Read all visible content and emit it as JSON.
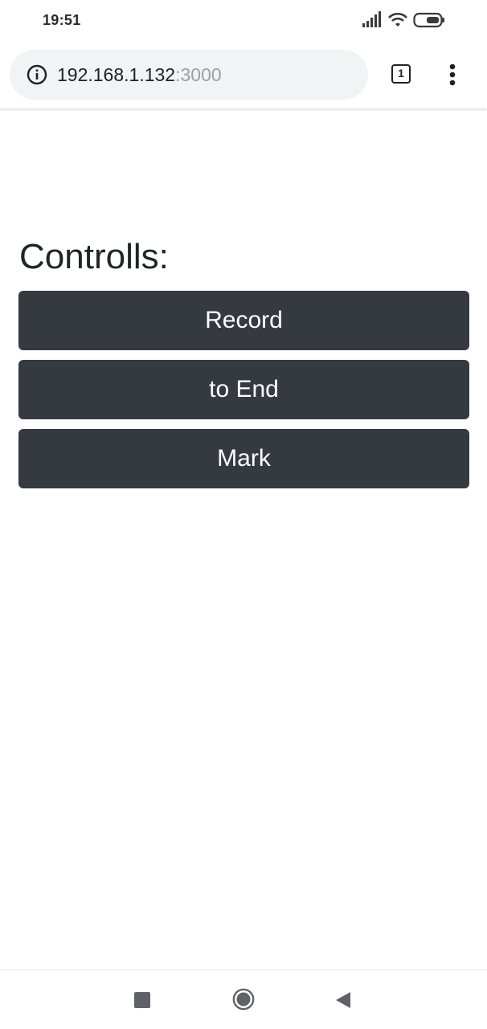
{
  "status_bar": {
    "time": "19:51",
    "icons": [
      "signal-icon",
      "wifi-icon",
      "battery-icon"
    ]
  },
  "browser": {
    "url_host": "192.168.1.132",
    "url_port": ":3000",
    "tab_count": "1",
    "icons": [
      "info-icon",
      "tab-switcher-icon",
      "more-vert-icon"
    ]
  },
  "page": {
    "title": "Controlls:",
    "buttons": {
      "record": "Record",
      "to_end": "to End",
      "mark": "Mark"
    },
    "button_color": "#343a40"
  },
  "nav_bar": {
    "icons": [
      "recent-apps-icon",
      "home-icon",
      "back-icon"
    ]
  }
}
